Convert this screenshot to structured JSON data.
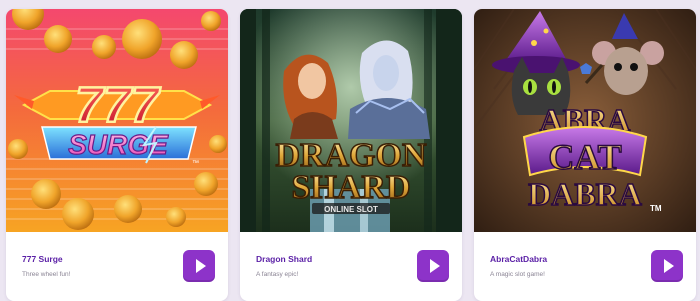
{
  "colors": {
    "page_background": "#ece6f2",
    "title_purple": "#5a1fa6",
    "play_button": "#8d33c9",
    "description_gray": "#8a8494"
  },
  "games": [
    {
      "title": "777 Surge",
      "description": "Three wheel fun!",
      "logo_top": "777",
      "logo_bottom": "SURGE",
      "trademark": "™",
      "play_icon": "play-icon"
    },
    {
      "title": "Dragon Shard",
      "description": "A fantasy epic!",
      "logo_top": "DRAGON",
      "logo_bottom": "SHARD",
      "logo_sub": "ONLINE SLOT",
      "play_icon": "play-icon"
    },
    {
      "title": "AbraCatDabra",
      "description": "A magic slot game!",
      "logo_top": "ABRA",
      "logo_mid": "CAT",
      "logo_bottom": "DABRA",
      "trademark": "TM",
      "play_icon": "play-icon"
    }
  ]
}
